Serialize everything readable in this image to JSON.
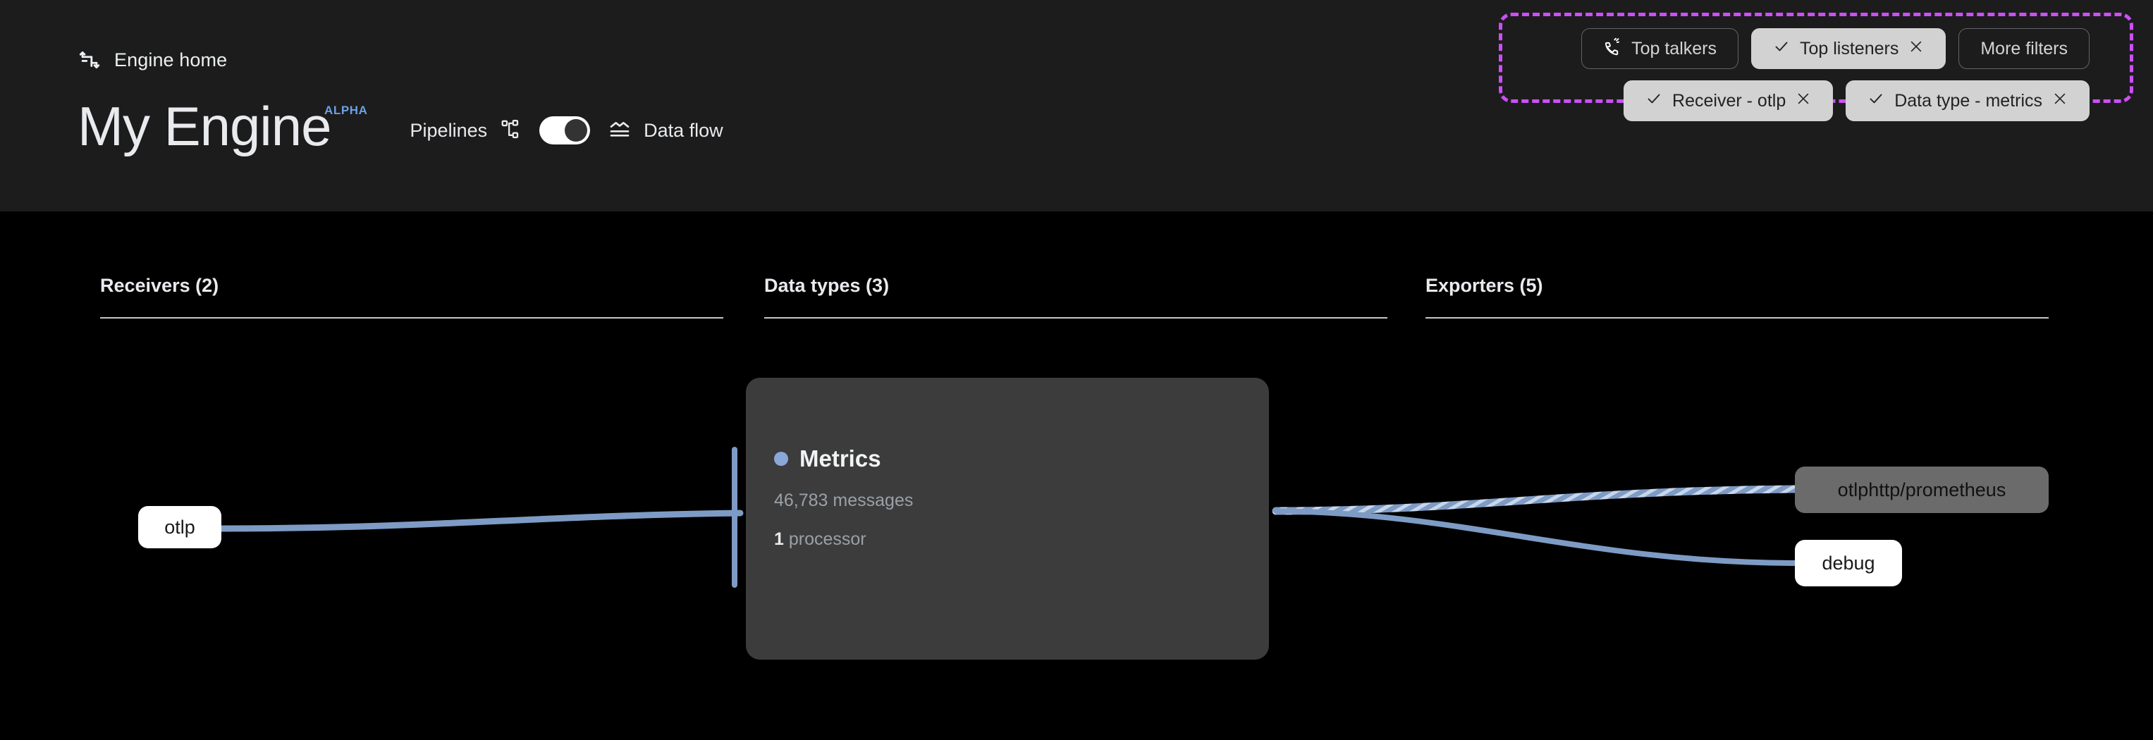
{
  "header": {
    "breadcrumb": {
      "icon": "transform-arrows-icon",
      "label": "Engine home"
    },
    "title": "My Engine",
    "badge": "ALPHA",
    "mode": {
      "left_label": "Pipelines",
      "left_icon": "account-tree-icon",
      "right_label": "Data flow",
      "right_icon": "data-flow-icon",
      "toggle_state": "right"
    }
  },
  "filters": {
    "annotation_color": "#cc4ff5",
    "row1": [
      {
        "label": "Top talkers",
        "icon": "ring-volume-icon",
        "selected": false,
        "removable": false
      },
      {
        "label": "Top listeners",
        "icon": "check-icon",
        "selected": true,
        "removable": true
      },
      {
        "label": "More filters",
        "icon": "",
        "selected": false,
        "removable": false
      }
    ],
    "row2": [
      {
        "label": "Receiver - otlp",
        "icon": "check-icon",
        "selected": true,
        "removable": true
      },
      {
        "label": "Data type - metrics",
        "icon": "check-icon",
        "selected": true,
        "removable": true
      }
    ]
  },
  "columns": [
    {
      "title": "Receivers (2)"
    },
    {
      "title": "Data types (3)"
    },
    {
      "title": "Exporters (5)"
    }
  ],
  "nodes": {
    "receiver": {
      "label": "otlp",
      "style": "white"
    },
    "exporters": [
      {
        "label": "otlphttp/prometheus",
        "style": "hover"
      },
      {
        "label": "debug",
        "style": "white"
      }
    ]
  },
  "card": {
    "title": "Metrics",
    "dot_color": "#8aa7d9",
    "messages": "46,783 messages",
    "processor_count": "1",
    "processor_label": "processor"
  },
  "colors": {
    "header_bg": "#1c1c1c",
    "canvas_bg": "#000000",
    "edge": "#7d9bc4",
    "accent_purple": "#cc4ff5",
    "alpha_blue": "#6ea0e3"
  }
}
